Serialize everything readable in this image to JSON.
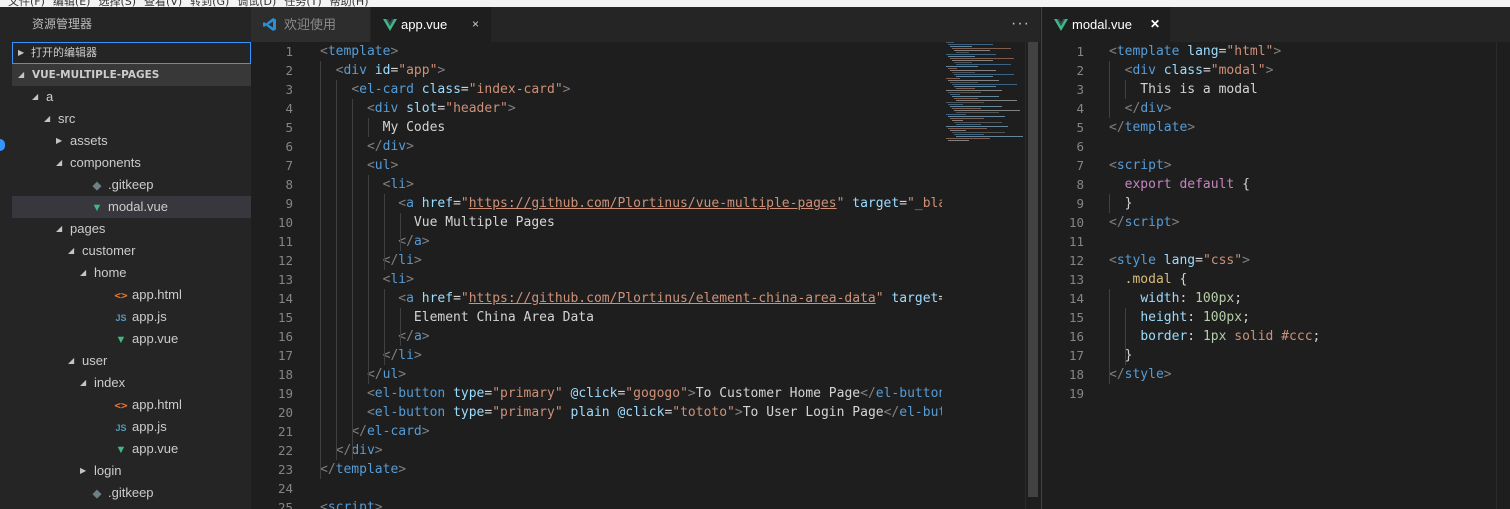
{
  "menu": [
    "文件(F)",
    "编辑(E)",
    "选择(S)",
    "查看(V)",
    "转到(G)",
    "调试(D)",
    "任务(T)",
    "帮助(H)"
  ],
  "sidebar": {
    "title": "资源管理器",
    "open_editors": "打开的编辑器",
    "project": "VUE-MULTIPLE-PAGES",
    "tree": [
      {
        "label": "a",
        "icon": "",
        "depth": 0,
        "twisty": "open"
      },
      {
        "label": "src",
        "icon": "",
        "depth": 1,
        "twisty": "open"
      },
      {
        "label": "assets",
        "icon": "",
        "depth": 2,
        "twisty": "closed"
      },
      {
        "label": "components",
        "icon": "",
        "depth": 2,
        "twisty": "open"
      },
      {
        "label": ".gitkeep",
        "icon": "git",
        "depth": 3,
        "twisty": ""
      },
      {
        "label": "modal.vue",
        "icon": "vue",
        "depth": 3,
        "twisty": "",
        "selected": true
      },
      {
        "label": "pages",
        "icon": "",
        "depth": 2,
        "twisty": "open"
      },
      {
        "label": "customer",
        "icon": "",
        "depth": 3,
        "twisty": "open"
      },
      {
        "label": "home",
        "icon": "",
        "depth": 4,
        "twisty": "open"
      },
      {
        "label": "app.html",
        "icon": "html",
        "depth": 5,
        "twisty": ""
      },
      {
        "label": "app.js",
        "icon": "js",
        "depth": 5,
        "twisty": ""
      },
      {
        "label": "app.vue",
        "icon": "vue",
        "depth": 5,
        "twisty": ""
      },
      {
        "label": "user",
        "icon": "",
        "depth": 3,
        "twisty": "open"
      },
      {
        "label": "index",
        "icon": "",
        "depth": 4,
        "twisty": "open"
      },
      {
        "label": "app.html",
        "icon": "html",
        "depth": 5,
        "twisty": ""
      },
      {
        "label": "app.js",
        "icon": "js",
        "depth": 5,
        "twisty": ""
      },
      {
        "label": "app.vue",
        "icon": "vue",
        "depth": 5,
        "twisty": ""
      },
      {
        "label": "login",
        "icon": "",
        "depth": 4,
        "twisty": "closed"
      },
      {
        "label": ".gitkeep",
        "icon": "git",
        "depth": 3,
        "twisty": ""
      }
    ]
  },
  "editor1": {
    "tabs": {
      "welcome": "欢迎使用",
      "active": "app.vue",
      "close": "×"
    },
    "more": "···",
    "lines": [
      [
        [
          "tg",
          "<"
        ],
        [
          "tn",
          "template"
        ],
        [
          "tg",
          ">"
        ]
      ],
      [
        [
          "tx",
          "  "
        ],
        [
          "tg",
          "<"
        ],
        [
          "tn",
          "div"
        ],
        [
          "tx",
          " "
        ],
        [
          "at",
          "id"
        ],
        [
          "tx",
          "="
        ],
        [
          "sv",
          "\"app\""
        ],
        [
          "tg",
          ">"
        ]
      ],
      [
        [
          "tx",
          "    "
        ],
        [
          "tg",
          "<"
        ],
        [
          "tn",
          "el-card"
        ],
        [
          "tx",
          " "
        ],
        [
          "at",
          "class"
        ],
        [
          "tx",
          "="
        ],
        [
          "sv",
          "\"index-card\""
        ],
        [
          "tg",
          ">"
        ]
      ],
      [
        [
          "tx",
          "      "
        ],
        [
          "tg",
          "<"
        ],
        [
          "tn",
          "div"
        ],
        [
          "tx",
          " "
        ],
        [
          "at",
          "slot"
        ],
        [
          "tx",
          "="
        ],
        [
          "sv",
          "\"header\""
        ],
        [
          "tg",
          ">"
        ]
      ],
      [
        [
          "tx",
          "        My Codes"
        ]
      ],
      [
        [
          "tx",
          "      "
        ],
        [
          "tg",
          "</"
        ],
        [
          "tn",
          "div"
        ],
        [
          "tg",
          ">"
        ]
      ],
      [
        [
          "tx",
          "      "
        ],
        [
          "tg",
          "<"
        ],
        [
          "tn",
          "ul"
        ],
        [
          "tg",
          ">"
        ]
      ],
      [
        [
          "tx",
          "        "
        ],
        [
          "tg",
          "<"
        ],
        [
          "tn",
          "li"
        ],
        [
          "tg",
          ">"
        ]
      ],
      [
        [
          "tx",
          "          "
        ],
        [
          "tg",
          "<"
        ],
        [
          "tn",
          "a"
        ],
        [
          "tx",
          " "
        ],
        [
          "at",
          "href"
        ],
        [
          "tx",
          "="
        ],
        [
          "sv",
          "\""
        ],
        [
          "sl",
          "https://github.com/Plortinus/vue-multiple-pages"
        ],
        [
          "sv",
          "\""
        ],
        [
          "tx",
          " "
        ],
        [
          "at",
          "target"
        ],
        [
          "tx",
          "="
        ],
        [
          "sv",
          "\"_blank\""
        ],
        [
          "tg",
          ">"
        ]
      ],
      [
        [
          "tx",
          "            Vue Multiple Pages"
        ]
      ],
      [
        [
          "tx",
          "          "
        ],
        [
          "tg",
          "</"
        ],
        [
          "tn",
          "a"
        ],
        [
          "tg",
          ">"
        ]
      ],
      [
        [
          "tx",
          "        "
        ],
        [
          "tg",
          "</"
        ],
        [
          "tn",
          "li"
        ],
        [
          "tg",
          ">"
        ]
      ],
      [
        [
          "tx",
          "        "
        ],
        [
          "tg",
          "<"
        ],
        [
          "tn",
          "li"
        ],
        [
          "tg",
          ">"
        ]
      ],
      [
        [
          "tx",
          "          "
        ],
        [
          "tg",
          "<"
        ],
        [
          "tn",
          "a"
        ],
        [
          "tx",
          " "
        ],
        [
          "at",
          "href"
        ],
        [
          "tx",
          "="
        ],
        [
          "sv",
          "\""
        ],
        [
          "sl",
          "https://github.com/Plortinus/element-china-area-data"
        ],
        [
          "sv",
          "\""
        ],
        [
          "tx",
          " "
        ],
        [
          "at",
          "target"
        ],
        [
          "tx",
          "="
        ],
        [
          "sv",
          "\"_blank\""
        ],
        [
          "tg",
          ">"
        ]
      ],
      [
        [
          "tx",
          "            Element China Area Data"
        ]
      ],
      [
        [
          "tx",
          "          "
        ],
        [
          "tg",
          "</"
        ],
        [
          "tn",
          "a"
        ],
        [
          "tg",
          ">"
        ]
      ],
      [
        [
          "tx",
          "        "
        ],
        [
          "tg",
          "</"
        ],
        [
          "tn",
          "li"
        ],
        [
          "tg",
          ">"
        ]
      ],
      [
        [
          "tx",
          "      "
        ],
        [
          "tg",
          "</"
        ],
        [
          "tn",
          "ul"
        ],
        [
          "tg",
          ">"
        ]
      ],
      [
        [
          "tx",
          "      "
        ],
        [
          "tg",
          "<"
        ],
        [
          "tn",
          "el-button"
        ],
        [
          "tx",
          " "
        ],
        [
          "at",
          "type"
        ],
        [
          "tx",
          "="
        ],
        [
          "sv",
          "\"primary\""
        ],
        [
          "tx",
          " "
        ],
        [
          "at",
          "@click"
        ],
        [
          "tx",
          "="
        ],
        [
          "sv",
          "\"gogogo\""
        ],
        [
          "tg",
          ">"
        ],
        [
          "tx",
          "To Customer Home Page"
        ],
        [
          "tg",
          "</"
        ],
        [
          "tn",
          "el-button"
        ],
        [
          "tg",
          ">"
        ]
      ],
      [
        [
          "tx",
          "      "
        ],
        [
          "tg",
          "<"
        ],
        [
          "tn",
          "el-button"
        ],
        [
          "tx",
          " "
        ],
        [
          "at",
          "type"
        ],
        [
          "tx",
          "="
        ],
        [
          "sv",
          "\"primary\""
        ],
        [
          "tx",
          " "
        ],
        [
          "at",
          "plain"
        ],
        [
          "tx",
          " "
        ],
        [
          "at",
          "@click"
        ],
        [
          "tx",
          "="
        ],
        [
          "sv",
          "\"tototo\""
        ],
        [
          "tg",
          ">"
        ],
        [
          "tx",
          "To User Login Page"
        ],
        [
          "tg",
          "</"
        ],
        [
          "tn",
          "el-button"
        ],
        [
          "tg",
          ">"
        ]
      ],
      [
        [
          "tx",
          "    "
        ],
        [
          "tg",
          "</"
        ],
        [
          "tn",
          "el-card"
        ],
        [
          "tg",
          ">"
        ]
      ],
      [
        [
          "tx",
          "  "
        ],
        [
          "tg",
          "</"
        ],
        [
          "tn",
          "div"
        ],
        [
          "tg",
          ">"
        ]
      ],
      [
        [
          "tg",
          "</"
        ],
        [
          "tn",
          "template"
        ],
        [
          "tg",
          ">"
        ]
      ],
      [],
      [
        [
          "tg",
          "<"
        ],
        [
          "tn",
          "script"
        ],
        [
          "tg",
          ">"
        ]
      ]
    ]
  },
  "editor2": {
    "tab": {
      "label": "modal.vue",
      "close": "✕"
    },
    "lines": [
      [
        [
          "tg",
          "<"
        ],
        [
          "tn",
          "template"
        ],
        [
          "tx",
          " "
        ],
        [
          "at",
          "lang"
        ],
        [
          "tx",
          "="
        ],
        [
          "sv",
          "\"html\""
        ],
        [
          "tg",
          ">"
        ]
      ],
      [
        [
          "tx",
          "  "
        ],
        [
          "tg",
          "<"
        ],
        [
          "tn",
          "div"
        ],
        [
          "tx",
          " "
        ],
        [
          "at",
          "class"
        ],
        [
          "tx",
          "="
        ],
        [
          "sv",
          "\"modal\""
        ],
        [
          "tg",
          ">"
        ]
      ],
      [
        [
          "tx",
          "    This is a modal"
        ]
      ],
      [
        [
          "tx",
          "  "
        ],
        [
          "tg",
          "</"
        ],
        [
          "tn",
          "div"
        ],
        [
          "tg",
          ">"
        ]
      ],
      [
        [
          "tg",
          "</"
        ],
        [
          "tn",
          "template"
        ],
        [
          "tg",
          ">"
        ]
      ],
      [],
      [
        [
          "tg",
          "<"
        ],
        [
          "tn",
          "script"
        ],
        [
          "tg",
          ">"
        ]
      ],
      [
        [
          "tx",
          "  "
        ],
        [
          "kw",
          "export"
        ],
        [
          "tx",
          " "
        ],
        [
          "kw",
          "default"
        ],
        [
          "tx",
          " {"
        ]
      ],
      [
        [
          "tx",
          "  }"
        ]
      ],
      [
        [
          "tg",
          "</"
        ],
        [
          "tn",
          "script"
        ],
        [
          "tg",
          ">"
        ]
      ],
      [],
      [
        [
          "tg",
          "<"
        ],
        [
          "tn",
          "style"
        ],
        [
          "tx",
          " "
        ],
        [
          "at",
          "lang"
        ],
        [
          "tx",
          "="
        ],
        [
          "sv",
          "\"css\""
        ],
        [
          "tg",
          ">"
        ]
      ],
      [
        [
          "tx",
          "  "
        ],
        [
          "cs",
          ".modal"
        ],
        [
          "tx",
          " {"
        ]
      ],
      [
        [
          "tx",
          "    "
        ],
        [
          "pr",
          "width"
        ],
        [
          "tx",
          ": "
        ],
        [
          "nm",
          "100px"
        ],
        [
          "tx",
          ";"
        ]
      ],
      [
        [
          "tx",
          "    "
        ],
        [
          "pr",
          "height"
        ],
        [
          "tx",
          ": "
        ],
        [
          "nm",
          "100px"
        ],
        [
          "tx",
          ";"
        ]
      ],
      [
        [
          "tx",
          "    "
        ],
        [
          "pr",
          "border"
        ],
        [
          "tx",
          ": "
        ],
        [
          "nm",
          "1px"
        ],
        [
          "tx",
          " "
        ],
        [
          "sv",
          "solid"
        ],
        [
          "tx",
          " "
        ],
        [
          "sv",
          "#ccc"
        ],
        [
          "tx",
          ";"
        ]
      ],
      [
        [
          "tx",
          "  }"
        ]
      ],
      [
        [
          "tg",
          "</"
        ],
        [
          "tn",
          "style"
        ],
        [
          "tg",
          ">"
        ]
      ],
      []
    ]
  }
}
